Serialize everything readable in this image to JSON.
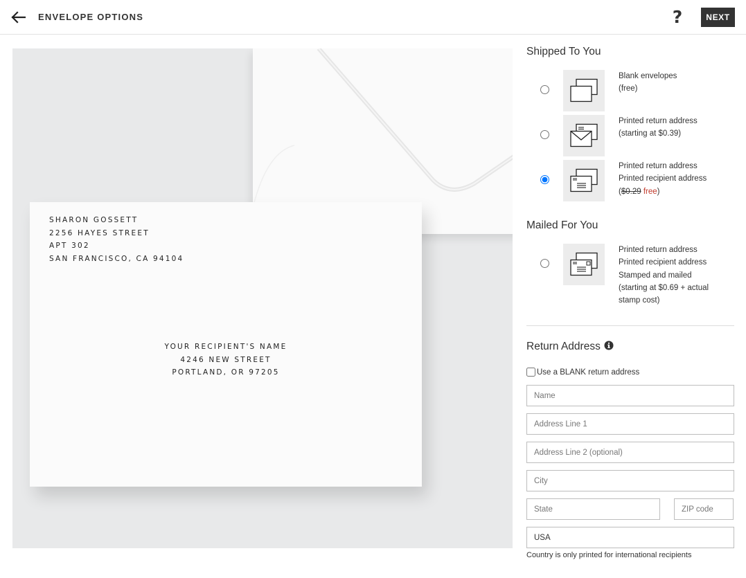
{
  "header": {
    "title": "ENVELOPE OPTIONS",
    "help_label": "?",
    "next_label": "NEXT"
  },
  "preview": {
    "return_address": [
      "SHARON GOSSETT",
      "2256 HAYES STREET",
      "APT 302",
      "SAN FRANCISCO, CA 94104"
    ],
    "recipient_address": [
      "YOUR RECIPIENT'S NAME",
      "4246 NEW STREET",
      "PORTLAND, OR 97205"
    ]
  },
  "shipped": {
    "title": "Shipped To You",
    "options": [
      {
        "line1": "Blank envelopes",
        "line2": "(free)",
        "selected": false,
        "icon": "blank-envelopes-icon"
      },
      {
        "line1": "Printed return address",
        "line2": "(starting at $0.39)",
        "selected": false,
        "icon": "printed-return-envelope-icon"
      },
      {
        "line1": "Printed return address",
        "line2": "Printed recipient address",
        "price_strike": "$0.29",
        "price_free": "free",
        "selected": true,
        "icon": "printed-both-envelope-icon"
      }
    ]
  },
  "mailed": {
    "title": "Mailed For You",
    "option": {
      "line1": "Printed return address",
      "line2": "Printed recipient address",
      "line3": "Stamped and mailed",
      "line4": "(starting at $0.69 + actual stamp cost)",
      "selected": false,
      "icon": "stamped-envelope-icon"
    }
  },
  "return_address": {
    "title": "Return Address",
    "blank_label": "Use a BLANK return address",
    "name_placeholder": "Name",
    "address1_placeholder": "Address Line 1",
    "address2_placeholder": "Address Line 2 (optional)",
    "city_placeholder": "City",
    "state_placeholder": "State",
    "zip_placeholder": "ZIP code",
    "country_value": "USA",
    "country_note": "Country is only printed for international recipients"
  },
  "colors": {
    "accent_dark": "#333333",
    "free_red": "#c0392b",
    "preview_bg": "#e8e9ea"
  }
}
